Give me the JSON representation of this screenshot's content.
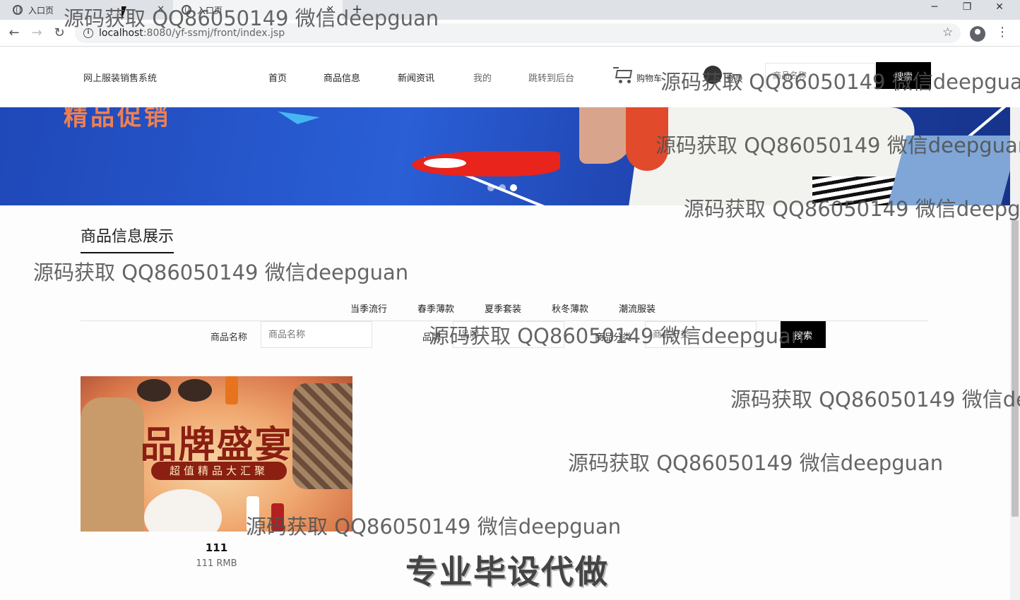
{
  "browser": {
    "tabs": [
      {
        "title": "入口页",
        "close": "✕"
      },
      {
        "title": "入口页",
        "close": "✕"
      }
    ],
    "new_tab": "+",
    "url_host": "localhost",
    "url_path": ":8080/yf-ssmj/front/index.jsp",
    "controls": {
      "minimize": "─",
      "maximize": "❐",
      "close": "✕"
    }
  },
  "header": {
    "brand": "网上服装销售系统",
    "nav": [
      "首页",
      "商品信息",
      "新闻资讯",
      "我的",
      "跳转到后台"
    ],
    "cart_label": "购物车",
    "login_label": "登录",
    "search_placeholder": "商品名称",
    "search_button": "搜索"
  },
  "banner": {
    "text": "精品促销",
    "dots": 3,
    "active_dot": 3
  },
  "section": {
    "title": "商品信息展示",
    "categories": [
      "当季流行",
      "春季薄款",
      "夏季套装",
      "秋冬薄款",
      "潮流服装"
    ]
  },
  "filters": {
    "name_label": "商品名称",
    "name_placeholder": "商品名称",
    "brand_label": "品牌",
    "brand_placeholder": "品牌",
    "category_label": "商品分类",
    "category_placeholder": "商品分类",
    "search_button": "搜索"
  },
  "products": [
    {
      "image_title": "品牌盛宴",
      "image_subtitle": "超值精品大汇聚",
      "name": "111",
      "price": "111 RMB"
    }
  ],
  "watermark": {
    "text": "源码获取 QQ86050149 微信deepguan",
    "footer_text": "专业毕设代做"
  }
}
